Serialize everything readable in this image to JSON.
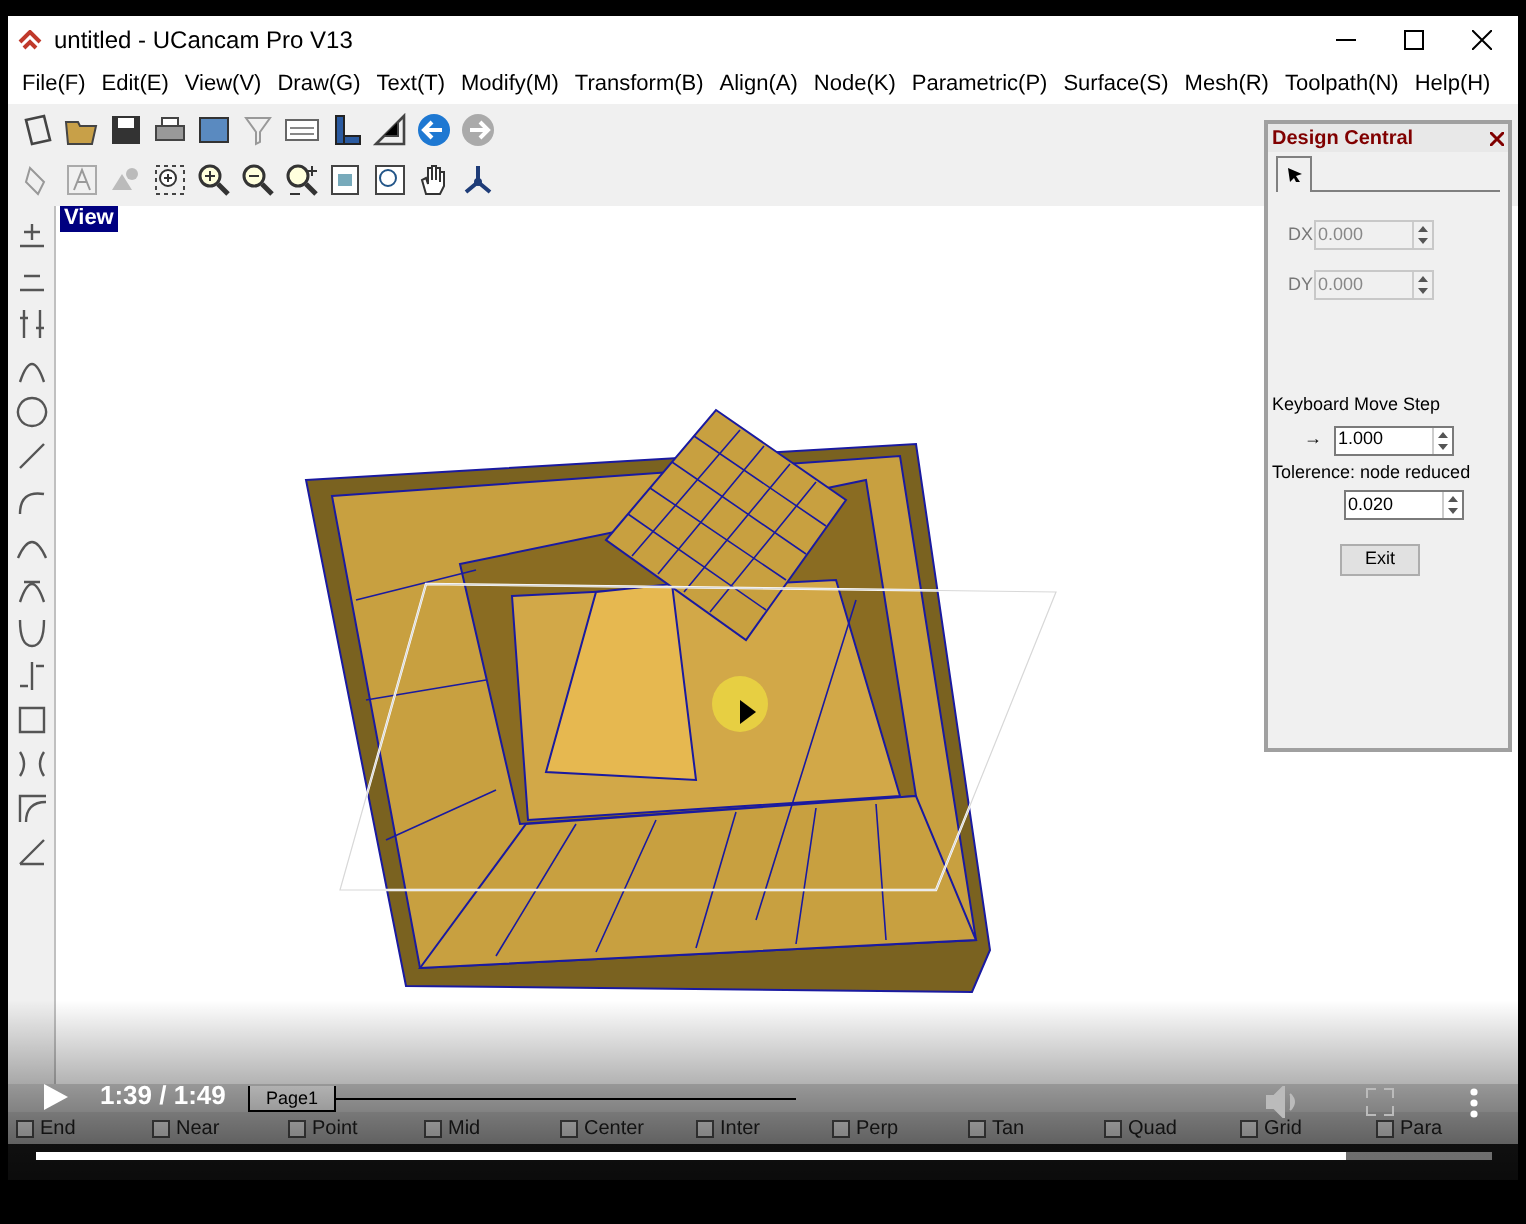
{
  "window": {
    "title": "untitled - UCancam Pro V13"
  },
  "menu": [
    "File(F)",
    "Edit(E)",
    "View(V)",
    "Draw(G)",
    "Text(T)",
    "Modify(M)",
    "Transform(B)",
    "Align(A)",
    "Node(K)",
    "Parametric(P)",
    "Surface(S)",
    "Mesh(R)",
    "Toolpath(N)",
    "Help(H)"
  ],
  "canvas": {
    "view_label": "View"
  },
  "design_central": {
    "title": "Design Central",
    "fields": [
      {
        "label": "DX",
        "value": "0.000",
        "disabled": true
      },
      {
        "label": "DY",
        "value": "0.000",
        "disabled": true
      }
    ],
    "move_step": {
      "label": "Keyboard Move Step",
      "arrow": "→",
      "value": "1.000",
      "disabled": false
    },
    "tolerance": {
      "label": "Tolerence: node reduced",
      "value": "0.020",
      "disabled": false
    },
    "exit_button": "Exit"
  },
  "page_tabs": [
    {
      "label": "Page1",
      "selected": true
    }
  ],
  "snaps": [
    {
      "label": "End",
      "checked": false
    },
    {
      "label": "Near",
      "checked": false
    },
    {
      "label": "Point",
      "checked": false
    },
    {
      "label": "Mid",
      "checked": false
    },
    {
      "label": "Center",
      "checked": false
    },
    {
      "label": "Inter",
      "checked": false
    },
    {
      "label": "Perp",
      "checked": false
    },
    {
      "label": "Tan",
      "checked": false
    },
    {
      "label": "Quad",
      "checked": false
    },
    {
      "label": "Grid",
      "checked": false
    },
    {
      "label": "Para",
      "checked": false
    }
  ],
  "video": {
    "time": "1:39 / 1:49",
    "level": 0.9
  }
}
